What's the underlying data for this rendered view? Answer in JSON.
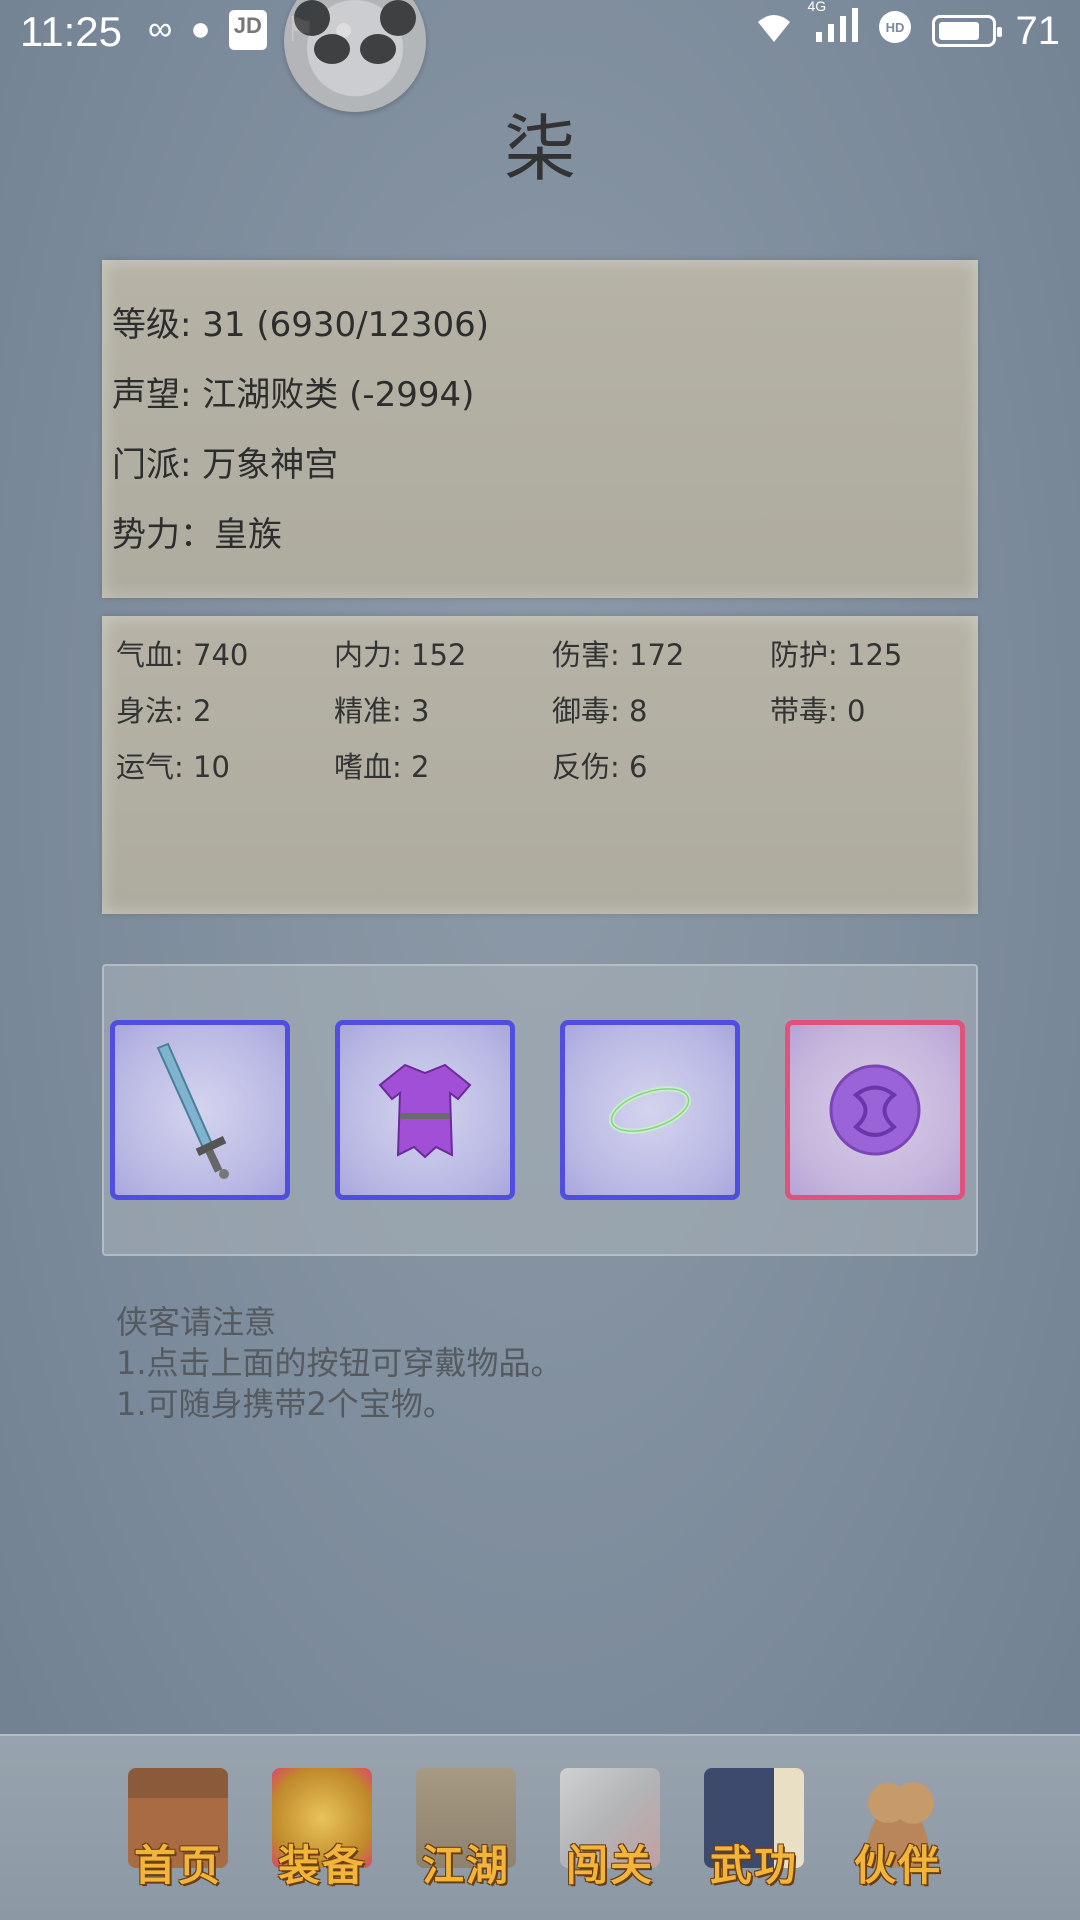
{
  "status_bar": {
    "time": "11:25",
    "network": "4G",
    "battery": "71",
    "jd_label": "JD"
  },
  "title": "柒",
  "info": {
    "level": "等级: 31 (6930/12306)",
    "reputation": "声望: 江湖败类 (-2994)",
    "sect": "门派: 万象神宫",
    "faction": "势力：皇族"
  },
  "stats": [
    "气血: 740",
    "内力: 152",
    "伤害: 172",
    "防护: 125",
    "身法: 2",
    "精准: 3",
    "御毒: 8",
    "带毒: 0",
    "运气: 10",
    "嗜血: 2",
    "反伤: 6"
  ],
  "equipment": [
    {
      "icon": "sword-icon",
      "border": "#4f4ee0"
    },
    {
      "icon": "robe-icon",
      "border": "#4f4ee0"
    },
    {
      "icon": "ring-icon",
      "border": "#4f4ee0"
    },
    {
      "icon": "orb-icon",
      "border": "#e0527a"
    }
  ],
  "tips": {
    "heading": "侠客请注意",
    "line1": "1.点击上面的按钮可穿戴物品。",
    "line2": "1.可随身携带2个宝物。"
  },
  "nav": [
    {
      "label": "首页",
      "icon": "home-icon"
    },
    {
      "label": "装备",
      "icon": "armor-icon"
    },
    {
      "label": "江湖",
      "icon": "map-scroll-icon"
    },
    {
      "label": "闯关",
      "icon": "crossed-swords-icon"
    },
    {
      "label": "武功",
      "icon": "book-icon"
    },
    {
      "label": "伙伴",
      "icon": "partners-icon"
    }
  ]
}
